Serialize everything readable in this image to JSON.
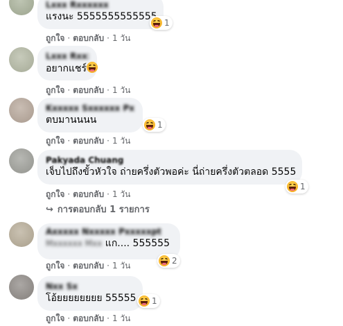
{
  "labels": {
    "like": "ถูกใจ",
    "reply": "ตอบกลับ",
    "time": "1 วัน",
    "dot": "·"
  },
  "comments": [
    {
      "author": "Lxxx Rxxxxxx",
      "text": "แรงนะ 5555555555555",
      "reaction": {
        "icon": "haha-emoji",
        "count": "1"
      }
    },
    {
      "author": "Lxxx Rxxxxxx",
      "text": "อยากแชร์",
      "inline_emoji": "haha-emoji"
    },
    {
      "author": "Kxxxxx Sxxxxxx Pxxxxxxxx",
      "text": "ตบมานนนน",
      "reaction": {
        "icon": "haha-emoji",
        "count": "1"
      }
    },
    {
      "author": "Pakyada Chuang",
      "text": "เจ็บไปถึงขั้วหัวใจ ถ่ายครึ่งตัวพอค่ะ นี่ถ่ายครึ่งตัวตลอด 5555",
      "reaction": {
        "icon": "haha-emoji",
        "count": "1"
      },
      "replies_link": "การตอบกลับ 1 รายการ"
    },
    {
      "author": "Axxxxx Nxxxxx Pxxxxxpt",
      "blurred_line": "Mxxxxxx Mxx",
      "text": "แก.... 555555",
      "reaction": {
        "icon": "haha-emoji",
        "count": "2"
      }
    },
    {
      "author": "Nxx Sx",
      "text": "โอ้ยยยยยยยย 55555",
      "reaction": {
        "icon": "haha-emoji",
        "count": "1"
      }
    }
  ],
  "colors": {
    "bubble": "#f0f2f5",
    "secondary_text": "#65676b",
    "haha": "#f7b125"
  }
}
